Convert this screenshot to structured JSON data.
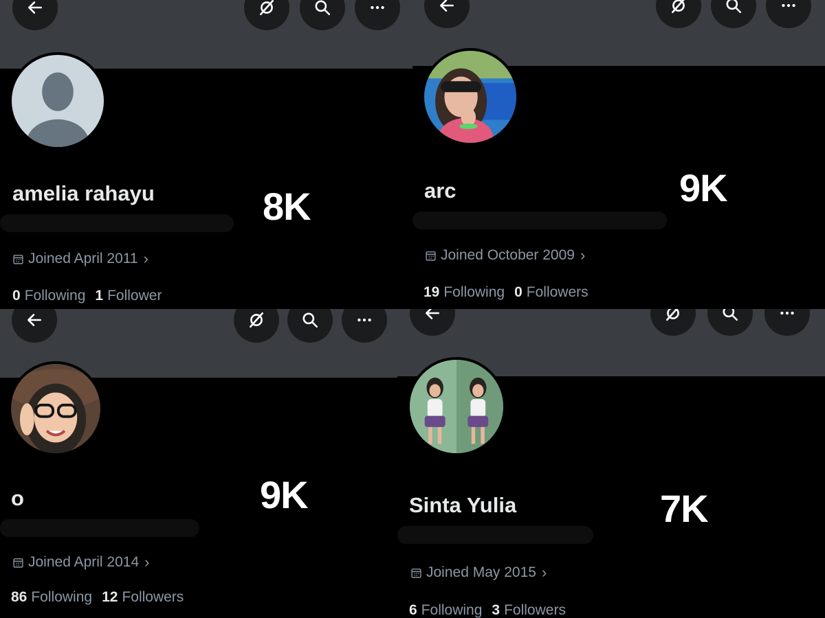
{
  "profiles": [
    {
      "name": "amelia rahayu",
      "big_count": "8K",
      "joined": "Joined April 2011",
      "following_count": "0",
      "following_label": "Following",
      "followers_count": "1",
      "followers_label": "Follower"
    },
    {
      "name": "arc",
      "big_count": "9K",
      "joined": "Joined October 2009",
      "following_count": "19",
      "following_label": "Following",
      "followers_count": "0",
      "followers_label": "Followers"
    },
    {
      "name": "o",
      "big_count": "9K",
      "joined": "Joined April 2014",
      "following_count": "86",
      "following_label": "Following",
      "followers_count": "12",
      "followers_label": "Followers"
    },
    {
      "name": "Sinta Yulia",
      "big_count": "7K",
      "joined": "Joined May 2015",
      "following_count": "6",
      "following_label": "Following",
      "followers_count": "3",
      "followers_label": "Followers"
    }
  ],
  "icons": {
    "back": "arrow-left-icon",
    "grok": "grok-icon",
    "search": "search-icon",
    "more": "more-icon",
    "calendar": "calendar-icon",
    "chevron": "chevron-right-icon"
  },
  "colors": {
    "banner": "#3a3d41",
    "button": "#1b1c1e",
    "muted_text": "#8b98a5",
    "primary_text": "#e7e9ea"
  }
}
